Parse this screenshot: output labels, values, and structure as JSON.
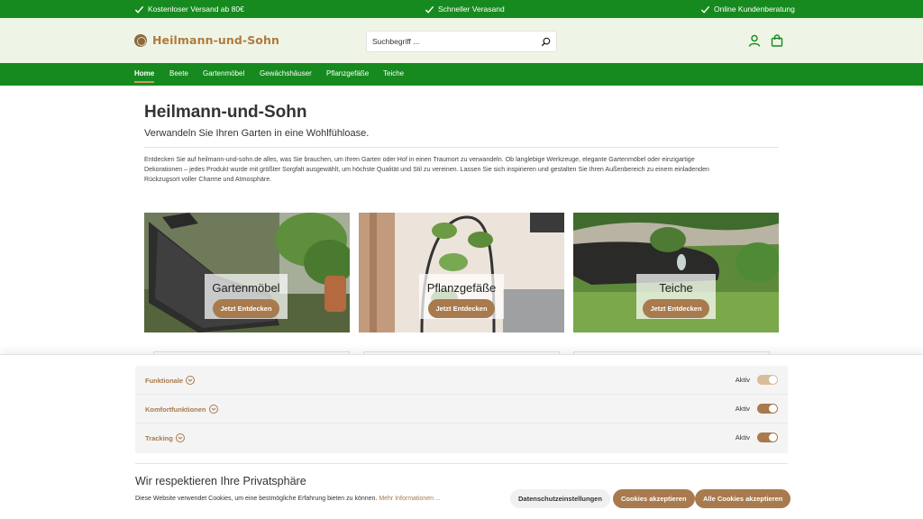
{
  "topbar": {
    "usps": [
      "Kostenloser Versand ab 80€",
      "Schneller Verasand",
      "Online Kundenberatung"
    ]
  },
  "header": {
    "logo_text": "Heilmann-und-Sohn",
    "search_placeholder": "Suchbegriff ...",
    "icons": [
      "account-icon",
      "cart-icon"
    ]
  },
  "nav": {
    "items": [
      "Home",
      "Beete",
      "Gartenmöbel",
      "Gewächshäuser",
      "Pflanzgefäße",
      "Teiche"
    ],
    "active_index": 0
  },
  "main": {
    "title": "Heilmann-und-Sohn",
    "subtitle": "Verwandeln Sie Ihren Garten in eine Wohlfühloase.",
    "intro_lines": [
      "Entdecken Sie auf heilmann-und-sohn.de alles, was Sie brauchen, um Ihren Garten oder Hof in einen Traumort zu verwandeln. Ob langlebige Werkzeuge, elegante Gartenmöbel oder einzigartige",
      "Dekorationen – jedes Produkt wurde mit größter Sorgfalt ausgewählt, um höchste Qualität und Stil zu vereinen. Lassen Sie sich inspirieren und gestalten Sie Ihren Außenbereich zu einem einladenden",
      "Rückzugsort voller Charme und Atmosphäre."
    ],
    "cards": [
      {
        "title": "Gartenmöbel",
        "button": "Jetzt Entdecken"
      },
      {
        "title": "Pflanzgefäße",
        "button": "Jetzt Entdecken"
      },
      {
        "title": "Teiche",
        "button": "Jetzt Entdecken"
      }
    ]
  },
  "cookie": {
    "categories": [
      {
        "name": "Funktionale",
        "status": "Aktiv",
        "enabled": true,
        "locked": true
      },
      {
        "name": "Komfortfunktionen",
        "status": "Aktiv",
        "enabled": true,
        "locked": false
      },
      {
        "name": "Tracking",
        "status": "Aktiv",
        "enabled": true,
        "locked": false
      }
    ],
    "title": "Wir respektieren Ihre Privatsphäre",
    "text": "Diese Website verwendet Cookies, um eine bestmögliche Erfahrung bieten zu können.",
    "link": "Mehr Informationen ...",
    "buttons": {
      "settings": "Datenschutzeinstellungen",
      "accept": "Cookies akzeptieren",
      "accept_all": "Alle Cookies akzeptieren"
    }
  },
  "colors": {
    "brand_green": "#168a1e",
    "header_bg": "#eef5e6",
    "accent_brown": "#a87a4d",
    "logo_brown": "#b07a3c",
    "toggle_locked": "#d7bd9c"
  }
}
